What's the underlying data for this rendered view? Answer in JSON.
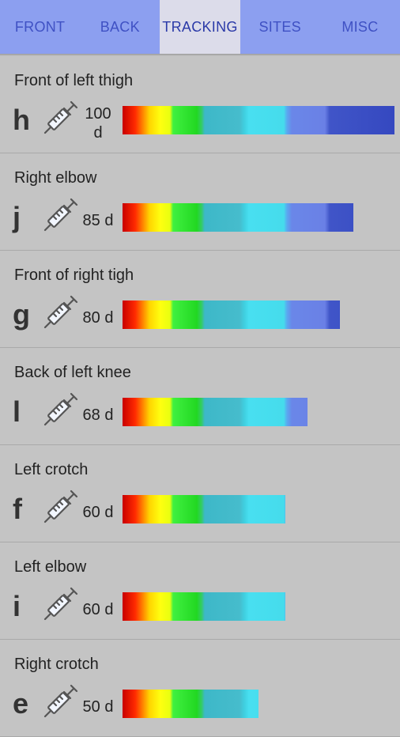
{
  "tabs": [
    {
      "label": "FRONT",
      "active": false
    },
    {
      "label": "BACK",
      "active": false
    },
    {
      "label": "TRACKING",
      "active": true
    },
    {
      "label": "SITES",
      "active": false
    },
    {
      "label": "MISC",
      "active": false
    }
  ],
  "colors": {
    "tabbar": "#8c9ff0",
    "active_tab": "#dcdcea",
    "background": "#c4c4c4"
  },
  "sites": [
    {
      "name": "Front of left thigh",
      "letter": "h",
      "days_label": "100 d",
      "days": 100
    },
    {
      "name": "Right elbow",
      "letter": "j",
      "days_label": "85 d",
      "days": 85
    },
    {
      "name": "Front of right tigh",
      "letter": "g",
      "days_label": "80 d",
      "days": 80
    },
    {
      "name": "Back of left knee",
      "letter": "l",
      "days_label": "68 d",
      "days": 68
    },
    {
      "name": "Left crotch",
      "letter": "f",
      "days_label": "60 d",
      "days": 60
    },
    {
      "name": "Left elbow",
      "letter": "i",
      "days_label": "60 d",
      "days": 60
    },
    {
      "name": "Right crotch",
      "letter": "e",
      "days_label": "50 d",
      "days": 50
    }
  ],
  "icons": {
    "injection": "syringe-icon"
  }
}
